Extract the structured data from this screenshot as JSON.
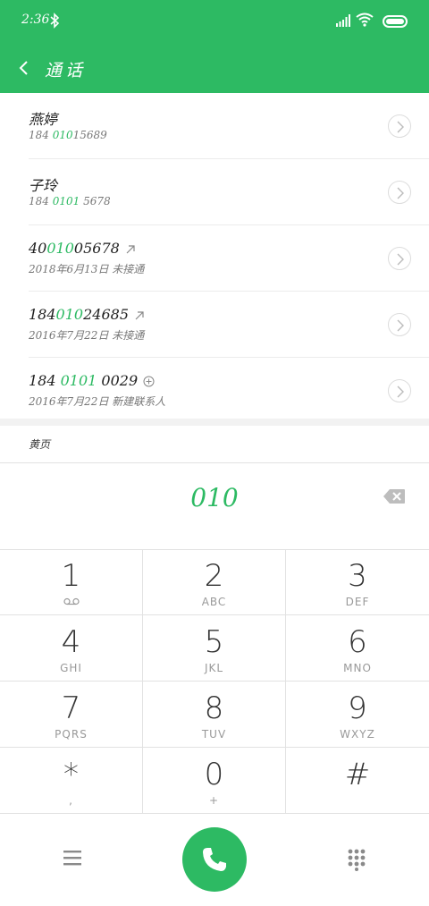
{
  "status": {
    "time": "2:36"
  },
  "appbar": {
    "title": "通话"
  },
  "calls": [
    {
      "name": "燕婷",
      "prefix": "184 ",
      "highlight": "010",
      "suffix": "15689"
    },
    {
      "name": "子玲",
      "prefix": "184 ",
      "highlight": "0101",
      "suffix": " 5678"
    },
    {
      "num_prefix": "40",
      "num_highlight": "010",
      "num_suffix": "05678",
      "detail": "2018年6月13日 未接通",
      "icon": "outgoing-arrow-icon"
    },
    {
      "num_prefix": "184",
      "num_highlight": "010",
      "num_suffix": "24685",
      "detail": "2016年7月22日 未接通",
      "icon": "outgoing-arrow-icon"
    },
    {
      "num_prefix": "184 ",
      "num_highlight": "0101",
      "num_suffix": " 0029",
      "detail": "2016年7月22日 新建联系人",
      "icon": "add-contact-icon"
    }
  ],
  "yellow_pages": {
    "label": "黄页"
  },
  "dial": {
    "digits": "010"
  },
  "keys": [
    {
      "digit": "1",
      "letters": ""
    },
    {
      "digit": "2",
      "letters": "ABC"
    },
    {
      "digit": "3",
      "letters": "DEF"
    },
    {
      "digit": "4",
      "letters": "GHI"
    },
    {
      "digit": "5",
      "letters": "JKL"
    },
    {
      "digit": "6",
      "letters": "MNO"
    },
    {
      "digit": "7",
      "letters": "PQRS"
    },
    {
      "digit": "8",
      "letters": "TUV"
    },
    {
      "digit": "9",
      "letters": "WXYZ"
    },
    {
      "digit": "*",
      "letters": ","
    },
    {
      "digit": "0",
      "letters": "+"
    },
    {
      "digit": "#",
      "letters": ""
    }
  ],
  "colors": {
    "accent": "#2dba63",
    "text": "#222222",
    "muted": "#777777"
  }
}
